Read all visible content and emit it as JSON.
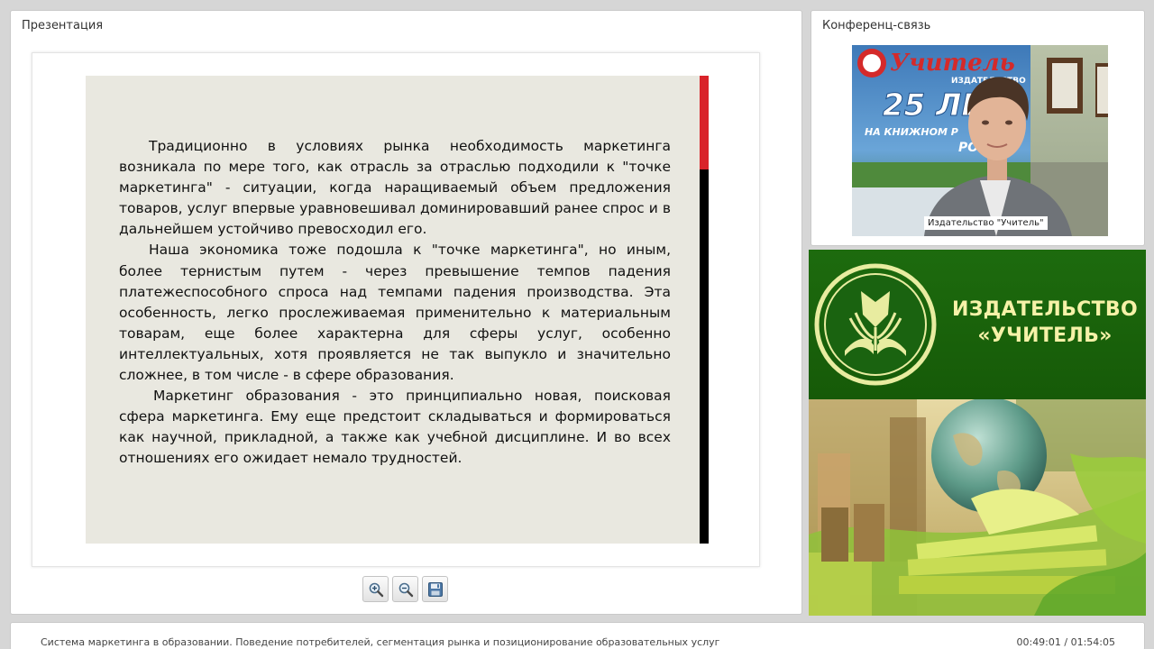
{
  "presentation": {
    "title": "Презентация",
    "slide": {
      "paragraphs": [
        "Традиционно в условиях рынка необходимость маркетинга возникала по мере того, как отрасль за отраслью подходили к \"точке маркетинга\" - ситуации, когда наращиваемый объем предложения товаров, услуг впервые уравновешивал доминировавший ранее спрос и в дальнейшем устойчиво превосходил его.",
        "Наша экономика тоже подошла к \"точке маркетинга\", но иным, более тернистым путем - через превышение темпов падения платежеспособного спроса над темпами падения производства. Эта особенность, легко прослеживаемая применительно к материальным товарам, еще более характерна для сферы услуг, особенно интеллектуальных, хотя проявляется не так выпукло и значительно сложнее, в том числе - в сфере образования.",
        "Маркетинг образования - это принципиально новая, поисковая сфера маркетинга. Ему еще предстоит складываться и формироваться как научной, прикладной, а также как учебной дисциплине. И во всех отношениях его ожидает немало трудностей."
      ],
      "accent_red": "#d9232a",
      "accent_black": "#000000"
    },
    "toolbar": {
      "zoom_in_icon": "zoom-in-icon",
      "zoom_out_icon": "zoom-out-icon",
      "save_icon": "floppy-disk-icon"
    }
  },
  "conference": {
    "title": "Конференц-связь",
    "video_caption": "Издательство \"Учитель\"",
    "poster_brand": "Учитель",
    "poster_sub": "ИЗДАТЕЛЬСТВО",
    "poster_years": "25 ЛЕТ",
    "poster_tagline_1": "НА КНИЖНОМ Р",
    "poster_tagline_2": "РОСС"
  },
  "brand": {
    "line1": "ИЗДАТЕЛЬСТВО",
    "line2": "«УЧИТЕЛЬ»",
    "bg_color": "#1d6b0e",
    "text_color": "#f6f2a8"
  },
  "footer": {
    "title": "Система маркетинга в образовании. Поведение потребителей, сегментация рынка и позиционирование образовательных услуг",
    "time": "00:49:01 / 01:54:05"
  }
}
